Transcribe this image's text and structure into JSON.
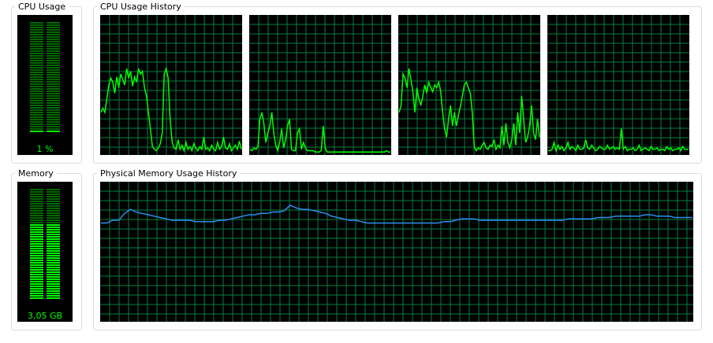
{
  "cpu_usage": {
    "label": "CPU Usage",
    "value_text": "1 %",
    "fraction": 0.01
  },
  "cpu_history": {
    "label": "CPU Usage History",
    "line_color": "#00ff00",
    "grid_color": "#008040",
    "cores": [
      {
        "values": [
          30,
          33,
          30,
          40,
          50,
          55,
          52,
          44,
          56,
          48,
          58,
          54,
          50,
          62,
          55,
          60,
          49,
          56,
          52,
          62,
          58,
          60,
          48,
          42,
          30,
          18,
          5,
          3,
          2,
          4,
          7,
          15,
          58,
          62,
          55,
          25,
          8,
          4,
          3,
          10,
          3,
          6,
          2,
          8,
          3,
          5,
          2,
          7,
          4,
          2,
          5,
          3,
          12,
          3,
          4,
          2,
          6,
          3,
          2,
          8,
          3,
          5,
          12,
          4,
          3,
          7,
          2,
          4,
          6,
          3,
          9,
          3
        ]
      },
      {
        "values": [
          3,
          2,
          4,
          3,
          5,
          25,
          30,
          22,
          8,
          15,
          20,
          30,
          15,
          6,
          2,
          8,
          18,
          4,
          10,
          20,
          25,
          3,
          2,
          2,
          15,
          18,
          3,
          8,
          4,
          2,
          2,
          2,
          2,
          1,
          1,
          1,
          2,
          20,
          4,
          1,
          1,
          1,
          1,
          1,
          1,
          1,
          1,
          1,
          1,
          1,
          1,
          1,
          1,
          1,
          1,
          1,
          1,
          1,
          1,
          1,
          1,
          1,
          1,
          1,
          1,
          1,
          1,
          1,
          1,
          2,
          1,
          1
        ]
      },
      {
        "values": [
          30,
          35,
          58,
          55,
          48,
          62,
          54,
          45,
          30,
          48,
          40,
          35,
          42,
          50,
          44,
          52,
          48,
          45,
          50,
          48,
          52,
          46,
          30,
          18,
          12,
          25,
          35,
          20,
          30,
          20,
          28,
          34,
          42,
          50,
          52,
          48,
          44,
          30,
          5,
          2,
          4,
          3,
          6,
          8,
          4,
          3,
          6,
          5,
          10,
          3,
          6,
          4,
          20,
          6,
          22,
          8,
          4,
          10,
          22,
          6,
          30,
          15,
          42,
          25,
          8,
          12,
          20,
          35,
          15,
          10,
          25,
          12
        ]
      },
      {
        "values": [
          2,
          2,
          3,
          8,
          2,
          6,
          3,
          5,
          2,
          4,
          8,
          3,
          5,
          4,
          2,
          6,
          3,
          3,
          4,
          10,
          4,
          3,
          6,
          4,
          2,
          3,
          5,
          4,
          3,
          3,
          6,
          3,
          4,
          5,
          3,
          4,
          3,
          18,
          3,
          5,
          2,
          3,
          3,
          4,
          2,
          3,
          6,
          2,
          3,
          4,
          3,
          2,
          5,
          3,
          3,
          4,
          2,
          3,
          3,
          2,
          5,
          3,
          4,
          2,
          3,
          3,
          4,
          2,
          5,
          3,
          3,
          3
        ]
      }
    ]
  },
  "memory": {
    "label": "Memory",
    "value_text": "3,05 GB",
    "fraction": 0.68
  },
  "memory_history": {
    "label": "Physical Memory Usage History",
    "line_color": "#2e8ff0",
    "grid_color": "#008040",
    "values": [
      71,
      71,
      73,
      73,
      78,
      81,
      79,
      78,
      77,
      76,
      75,
      74,
      73,
      73,
      73,
      73,
      72,
      72,
      72,
      72,
      73,
      73,
      74,
      75,
      76,
      77,
      77,
      78,
      78,
      79,
      79,
      80,
      84,
      82,
      81,
      81,
      80,
      79,
      78,
      76,
      75,
      74,
      73,
      73,
      72,
      71,
      71,
      71,
      71,
      71,
      71,
      71,
      71,
      71,
      71,
      71,
      71,
      71,
      72,
      72,
      73,
      74,
      74,
      74,
      73,
      73,
      73,
      73,
      73,
      73,
      73,
      73,
      73,
      73,
      73,
      73,
      73,
      73,
      73,
      74,
      74,
      74,
      74,
      74,
      75,
      75,
      75,
      76,
      76,
      76,
      76,
      76,
      77,
      77,
      76,
      76,
      76,
      75,
      75,
      75,
      75
    ]
  }
}
